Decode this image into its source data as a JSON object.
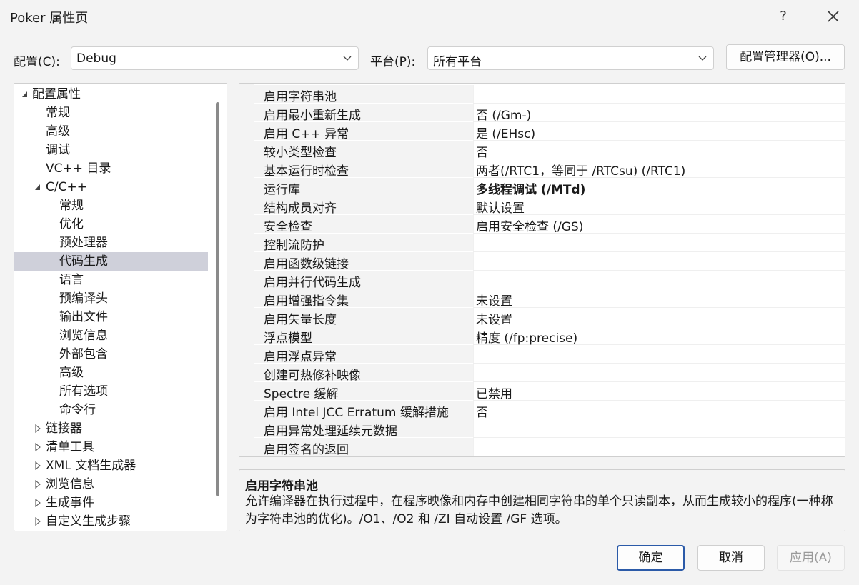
{
  "window": {
    "title": "Poker 属性页",
    "help": "?"
  },
  "config": {
    "config_label": "配置(C):",
    "config_value": "Debug",
    "platform_label": "平台(P):",
    "platform_value": "所有平台",
    "manager_button": "配置管理器(O)..."
  },
  "tree": {
    "items": [
      {
        "label": "配置属性",
        "toggle": "expanded",
        "level": 0
      },
      {
        "label": "常规",
        "toggle": "none",
        "level": 1
      },
      {
        "label": "高级",
        "toggle": "none",
        "level": 1
      },
      {
        "label": "调试",
        "toggle": "none",
        "level": 1
      },
      {
        "label": "VC++ 目录",
        "toggle": "none",
        "level": 1
      },
      {
        "label": "C/C++",
        "toggle": "expanded",
        "level": 1
      },
      {
        "label": "常规",
        "toggle": "none",
        "level": 2
      },
      {
        "label": "优化",
        "toggle": "none",
        "level": 2
      },
      {
        "label": "预处理器",
        "toggle": "none",
        "level": 2
      },
      {
        "label": "代码生成",
        "toggle": "none",
        "level": 2,
        "selected": true
      },
      {
        "label": "语言",
        "toggle": "none",
        "level": 2
      },
      {
        "label": "预编译头",
        "toggle": "none",
        "level": 2
      },
      {
        "label": "输出文件",
        "toggle": "none",
        "level": 2
      },
      {
        "label": "浏览信息",
        "toggle": "none",
        "level": 2
      },
      {
        "label": "外部包含",
        "toggle": "none",
        "level": 2
      },
      {
        "label": "高级",
        "toggle": "none",
        "level": 2
      },
      {
        "label": "所有选项",
        "toggle": "none",
        "level": 2
      },
      {
        "label": "命令行",
        "toggle": "none",
        "level": 2
      },
      {
        "label": "链接器",
        "toggle": "collapsed",
        "level": 1
      },
      {
        "label": "清单工具",
        "toggle": "collapsed",
        "level": 1
      },
      {
        "label": "XML 文档生成器",
        "toggle": "collapsed",
        "level": 1
      },
      {
        "label": "浏览信息",
        "toggle": "collapsed",
        "level": 1
      },
      {
        "label": "生成事件",
        "toggle": "collapsed",
        "level": 1
      },
      {
        "label": "自定义生成步骤",
        "toggle": "collapsed",
        "level": 1
      }
    ]
  },
  "grid": {
    "rows": [
      {
        "name": "启用字符串池",
        "value": "",
        "selected": true
      },
      {
        "name": "启用最小重新生成",
        "value": "否 (/Gm-)"
      },
      {
        "name": "启用 C++ 异常",
        "value": "是 (/EHsc)"
      },
      {
        "name": "较小类型检查",
        "value": "否"
      },
      {
        "name": "基本运行时检查",
        "value": "两者(/RTC1，等同于 /RTCsu) (/RTC1)"
      },
      {
        "name": "运行库",
        "value": "多线程调试 (/MTd)",
        "bold": true
      },
      {
        "name": "结构成员对齐",
        "value": "默认设置"
      },
      {
        "name": "安全检查",
        "value": "启用安全检查 (/GS)"
      },
      {
        "name": "控制流防护",
        "value": ""
      },
      {
        "name": "启用函数级链接",
        "value": ""
      },
      {
        "name": "启用并行代码生成",
        "value": ""
      },
      {
        "name": "启用增强指令集",
        "value": "未设置"
      },
      {
        "name": "启用矢量长度",
        "value": "未设置"
      },
      {
        "name": "浮点模型",
        "value": "精度 (/fp:precise)"
      },
      {
        "name": "启用浮点异常",
        "value": ""
      },
      {
        "name": "创建可热修补映像",
        "value": ""
      },
      {
        "name": "Spectre 缓解",
        "value": "已禁用"
      },
      {
        "name": "启用 Intel JCC Erratum 缓解措施",
        "value": "否"
      },
      {
        "name": "启用异常处理延续元数据",
        "value": ""
      },
      {
        "name": "启用签名的返回",
        "value": ""
      }
    ]
  },
  "description": {
    "title": "启用字符串池",
    "text": "允许编译器在执行过程中，在程序映像和内存中创建相同字符串的单个只读副本，从而生成较小的程序(一种称为字符串池的优化)。/O1、/O2 和 /ZI 自动设置 /GF 选项。"
  },
  "buttons": {
    "ok": "确定",
    "cancel": "取消",
    "apply": "应用(A)"
  },
  "icons": {
    "close": "close-icon",
    "dropdown": "chevron-down-icon",
    "expanded": "triangle-expanded-icon",
    "collapsed": "triangle-collapsed-icon"
  },
  "colors": {
    "selection": "#cfd0da",
    "ok_border": "#2b5aa8",
    "background": "#f3f3f3"
  }
}
